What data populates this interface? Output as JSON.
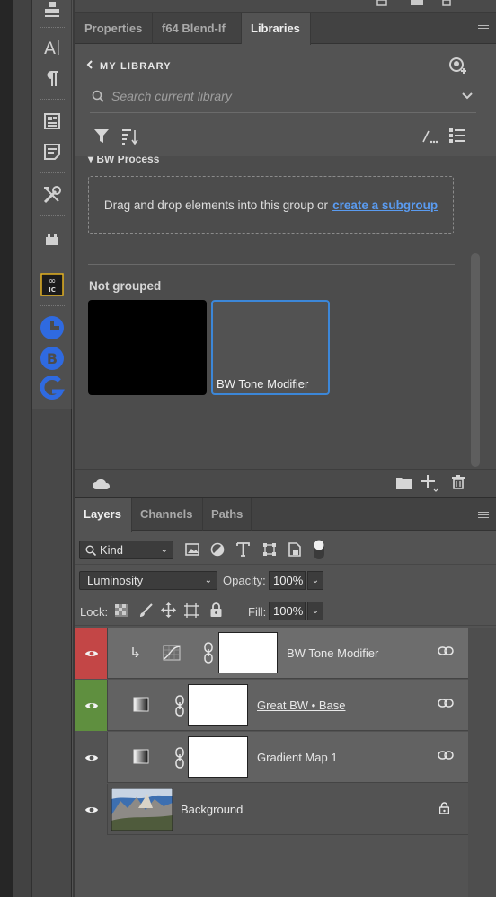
{
  "left_tools": [
    {
      "icon": "stamp-icon"
    },
    {
      "icon": "character-icon"
    },
    {
      "icon": "paragraph-icon"
    },
    {
      "icon": "article-icon"
    },
    {
      "icon": "notes-icon"
    },
    {
      "icon": "tools-icon"
    },
    {
      "icon": "plugin-icon"
    },
    {
      "icon": "infinite-color-icon",
      "text": "IC"
    },
    {
      "icon": "blue-c-icon"
    },
    {
      "icon": "blue-b-icon"
    },
    {
      "icon": "blue-s-icon"
    }
  ],
  "libraries": {
    "tabs": [
      "Properties",
      "f64 Blend-If",
      "Libraries"
    ],
    "active_tab": "Libraries",
    "library_name": "MY LIBRARY",
    "search_placeholder": "Search current library",
    "group_name": "BW Process",
    "dropzone_text": "Drag and drop elements into this group or",
    "dropzone_link": "create a subgroup",
    "not_grouped_label": "Not grouped",
    "assets": [
      {
        "label": "",
        "color": "#000000"
      },
      {
        "label": "BW Tone Modifier",
        "color": "#525252"
      }
    ],
    "bottom_icons": [
      "cloud-icon",
      "folder-icon",
      "add-icon",
      "trash-icon"
    ]
  },
  "layers_panel": {
    "tabs": [
      "Layers",
      "Channels",
      "Paths"
    ],
    "active_tab": "Layers",
    "filter": {
      "label": "Kind"
    },
    "blend_mode": "Luminosity",
    "opacity_label": "Opacity:",
    "opacity_value": "100%",
    "lock_label": "Lock:",
    "fill_label": "Fill:",
    "fill_value": "100%",
    "layers": [
      {
        "name": "BW Tone Modifier",
        "eye_color": "#c34646",
        "selected": true,
        "type": "curves"
      },
      {
        "name": "Great BW • Base",
        "eye_color": "#5f8f3f",
        "selected": false,
        "type": "gradient",
        "underline": true
      },
      {
        "name": "Gradient Map 1",
        "eye_color": "#535353",
        "selected": false,
        "type": "gradient"
      },
      {
        "name": "Background",
        "eye_color": "#535353",
        "selected": false,
        "type": "image"
      }
    ]
  }
}
